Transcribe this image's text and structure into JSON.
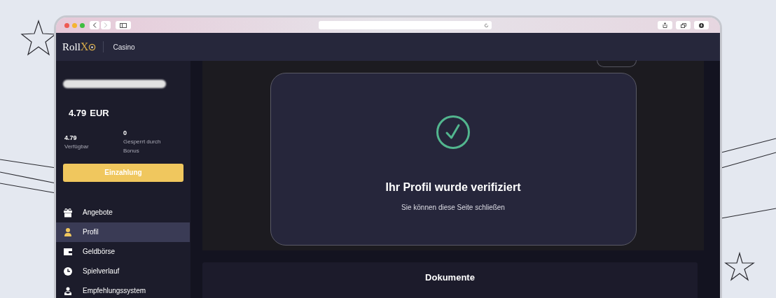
{
  "browser": {
    "nav_back_disabled": false,
    "nav_forward_disabled": true
  },
  "header": {
    "logo_part_1": "Roll",
    "logo_part_2": "X",
    "section": "Casino"
  },
  "account": {
    "balance": "4.79",
    "currency": "EUR",
    "available": {
      "value": "4.79",
      "label": "Verfügbar"
    },
    "locked": {
      "value": "0",
      "label": "Gesperrt durch Bonus"
    },
    "deposit_button": "Einzahlung"
  },
  "nav": [
    {
      "label": "Angebote",
      "selected": false
    },
    {
      "label": "Profil",
      "selected": true
    },
    {
      "label": "Geldbörse",
      "selected": false
    },
    {
      "label": "Spielverlauf",
      "selected": false
    },
    {
      "label": "Empfehlungssystem",
      "selected": false
    }
  ],
  "verification": {
    "title": "Ihr Profil wurde verifiziert",
    "message": "Sie können diese Seite schließen"
  },
  "documents": {
    "title": "Dokumente"
  }
}
